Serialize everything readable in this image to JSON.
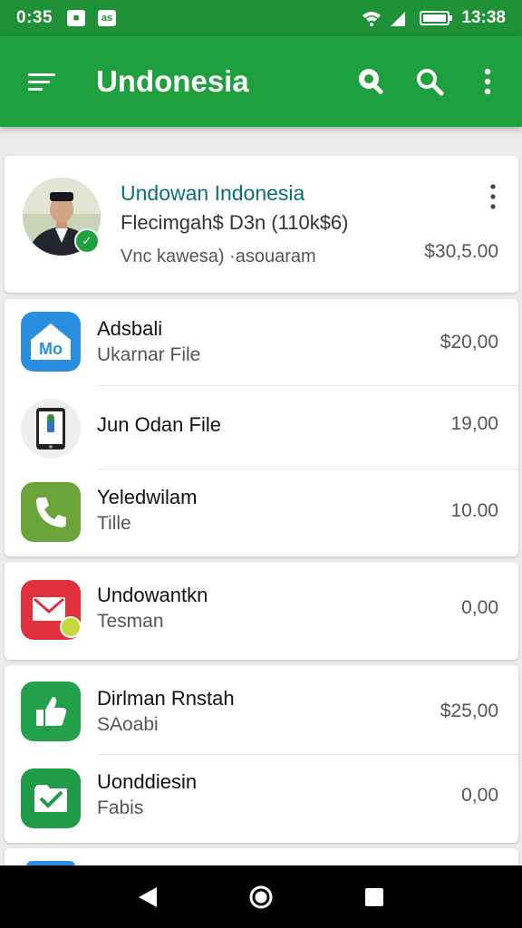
{
  "status_bar": {
    "time_left": "0:35",
    "notif1": "■",
    "notif2": "as",
    "time_right": "13:38"
  },
  "app_bar": {
    "title": "Undonesia"
  },
  "profile": {
    "name": "Undowan Indonesia",
    "subtitle": "Flecimgah$ D3n (110k$6)",
    "line3": "Vnc kawesa) ·asouaram",
    "amount": "$30,5.00"
  },
  "items": [
    {
      "name": "Adsbali",
      "detail": "Ukarnar File",
      "amount": "$20,00",
      "icon": "home-icon",
      "color": "#2a8ee0"
    },
    {
      "name": "Jun Odan File",
      "detail": "",
      "amount": "19,00",
      "icon": "tablet-icon",
      "color": "#eeeeee"
    },
    {
      "name": "Yeledwilam",
      "detail": "Tille",
      "amount": "10.00",
      "icon": "phone-icon",
      "color": "#6ba43a"
    },
    {
      "name": "Undowantkn",
      "detail": "Tesman",
      "amount": "0,00",
      "icon": "mail-icon",
      "color": "#e0303c"
    },
    {
      "name": "Dirlman Rnstah",
      "detail": "SAoabi",
      "amount": "$25,00",
      "icon": "thumbs-up-icon",
      "color": "#23a04a"
    },
    {
      "name": "Uonddiesin",
      "detail": "Fabis",
      "amount": "0,00",
      "icon": "check-folder-icon",
      "color": "#1e9a48"
    }
  ],
  "colors": {
    "primary": "#1ea03e",
    "status_bar": "#1e9137",
    "name_accent": "#0a6f7a"
  }
}
